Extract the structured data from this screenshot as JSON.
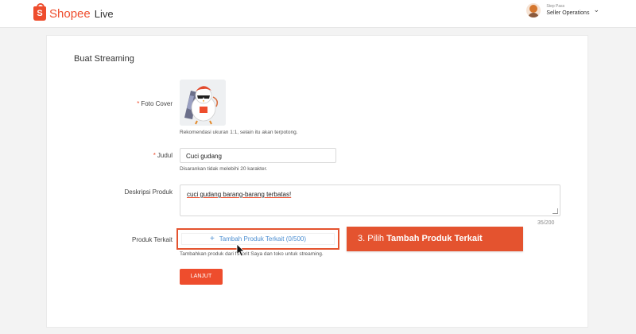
{
  "header": {
    "brand": "Shopee",
    "product": "Live",
    "logo_letter": "S",
    "user_small": "Step Pass",
    "user_name": "Seller Operations"
  },
  "form": {
    "title": "Buat Streaming",
    "cover": {
      "label": "Foto Cover",
      "required_mark": "*",
      "hint": "Rekomendasi ukuran 1:1, selain itu akan terpotong."
    },
    "judul": {
      "label": "Judul",
      "required_mark": "*",
      "value": "Cuci gudang",
      "hint": "Disarankan tidak melebihi 20 karakter."
    },
    "deskripsi": {
      "label": "Deskripsi Produk",
      "value": "cuci gudang barang-barang terbatas!",
      "counter": "35/200"
    },
    "produk": {
      "label": "Produk Terkait",
      "add_button": "Tambah Produk Terkait (0/500)",
      "hint": "Tambahkan produk dari favorit Saya dan toko untuk streaming."
    },
    "next_button": "LANJUT"
  },
  "callout": {
    "prefix": "3. Pilih ",
    "bold": "Tambah Produk Terkait"
  },
  "colors": {
    "accent": "#ee4d2d",
    "link": "#4d8fd1",
    "highlight": "#e4532f"
  }
}
